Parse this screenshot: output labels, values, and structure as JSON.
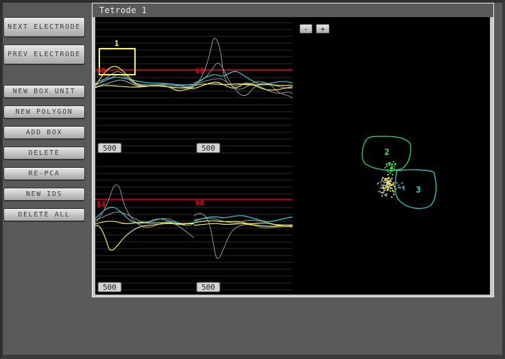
{
  "window": {
    "title": "Tetrode 1"
  },
  "sidebar": {
    "next_electrode": "NEXT ELECTRODE",
    "prev_electrode": "PREV ELECTRODE",
    "new_box_unit": "NEW BOX UNIT",
    "new_polygon": "NEW POLYGON",
    "add_box": "ADD BOX",
    "delete": "DELETE",
    "re_pca": "RE-PCA",
    "new_ids": "NEW IDS",
    "delete_all": "DELETE ALL"
  },
  "channels": [
    {
      "threshold": "60",
      "scale": "500"
    },
    {
      "threshold": "60",
      "scale": "500"
    },
    {
      "threshold": "84",
      "scale": "500"
    },
    {
      "threshold": "90",
      "scale": "500"
    }
  ],
  "box_unit": {
    "label": "1"
  },
  "pca": {
    "zoom_out": "-",
    "zoom_in": "+",
    "clusters": [
      {
        "label": "2",
        "color": "#2cf04a"
      },
      {
        "label": "3",
        "color": "#1ee0e0"
      }
    ]
  },
  "colors": {
    "threshold": "#e0001c",
    "box": "#ffff30",
    "cyan": "#22d8e0",
    "yellow": "#f6f04a",
    "gray": "#9a9a9a",
    "green": "#2cf04a"
  }
}
